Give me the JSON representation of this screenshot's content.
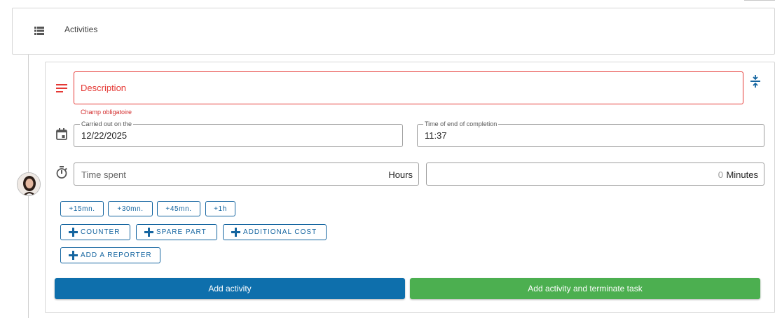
{
  "header": {
    "icon": "list-icon",
    "title": "Activities"
  },
  "form": {
    "description": {
      "icon": "notes-icon",
      "placeholder": "Description",
      "error": "Champ obligatoire",
      "collapse_icon": "collapse-vertical-icon"
    },
    "date": {
      "icon": "calendar-icon",
      "carried_out_label": "Carried out on the",
      "carried_out_value": "12/22/2025",
      "end_label": "Time of end of completion",
      "end_value": "11:37"
    },
    "time_spent": {
      "icon": "timer-icon",
      "placeholder": "Time spent",
      "hours_unit": "Hours",
      "minutes_value": "0",
      "minutes_unit": "Minutes"
    },
    "quick_add": [
      "+15mn.",
      "+30mn.",
      "+45mn.",
      "+1h"
    ],
    "extras": [
      "COUNTER",
      "SPARE PART",
      "ADDITIONAL COST"
    ],
    "reporter": "ADD A REPORTER"
  },
  "actions": {
    "add": "Add activity",
    "add_terminate": "Add activity and terminate task"
  },
  "colors": {
    "primary": "#0e6fac",
    "success": "#4caf50",
    "error": "#e53935",
    "outline_blue": "#1565a0"
  }
}
